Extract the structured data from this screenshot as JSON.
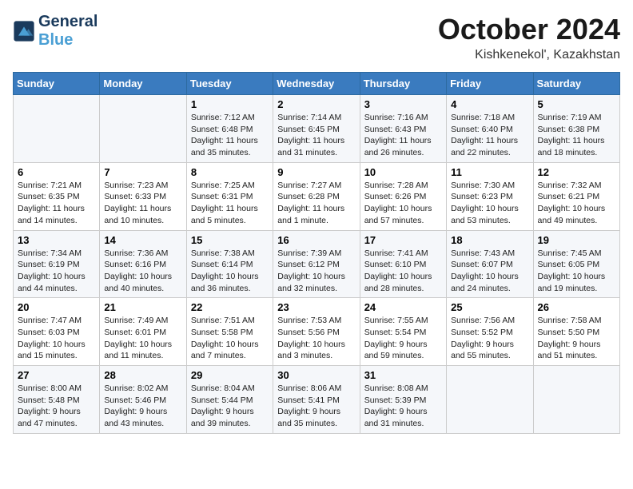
{
  "logo": {
    "line1": "General",
    "line2": "Blue"
  },
  "title": "October 2024",
  "location": "Kishkenekol', Kazakhstan",
  "days_of_week": [
    "Sunday",
    "Monday",
    "Tuesday",
    "Wednesday",
    "Thursday",
    "Friday",
    "Saturday"
  ],
  "weeks": [
    [
      {
        "day": "",
        "info": ""
      },
      {
        "day": "",
        "info": ""
      },
      {
        "day": "1",
        "info": "Sunrise: 7:12 AM\nSunset: 6:48 PM\nDaylight: 11 hours\nand 35 minutes."
      },
      {
        "day": "2",
        "info": "Sunrise: 7:14 AM\nSunset: 6:45 PM\nDaylight: 11 hours\nand 31 minutes."
      },
      {
        "day": "3",
        "info": "Sunrise: 7:16 AM\nSunset: 6:43 PM\nDaylight: 11 hours\nand 26 minutes."
      },
      {
        "day": "4",
        "info": "Sunrise: 7:18 AM\nSunset: 6:40 PM\nDaylight: 11 hours\nand 22 minutes."
      },
      {
        "day": "5",
        "info": "Sunrise: 7:19 AM\nSunset: 6:38 PM\nDaylight: 11 hours\nand 18 minutes."
      }
    ],
    [
      {
        "day": "6",
        "info": "Sunrise: 7:21 AM\nSunset: 6:35 PM\nDaylight: 11 hours\nand 14 minutes."
      },
      {
        "day": "7",
        "info": "Sunrise: 7:23 AM\nSunset: 6:33 PM\nDaylight: 11 hours\nand 10 minutes."
      },
      {
        "day": "8",
        "info": "Sunrise: 7:25 AM\nSunset: 6:31 PM\nDaylight: 11 hours\nand 5 minutes."
      },
      {
        "day": "9",
        "info": "Sunrise: 7:27 AM\nSunset: 6:28 PM\nDaylight: 11 hours\nand 1 minute."
      },
      {
        "day": "10",
        "info": "Sunrise: 7:28 AM\nSunset: 6:26 PM\nDaylight: 10 hours\nand 57 minutes."
      },
      {
        "day": "11",
        "info": "Sunrise: 7:30 AM\nSunset: 6:23 PM\nDaylight: 10 hours\nand 53 minutes."
      },
      {
        "day": "12",
        "info": "Sunrise: 7:32 AM\nSunset: 6:21 PM\nDaylight: 10 hours\nand 49 minutes."
      }
    ],
    [
      {
        "day": "13",
        "info": "Sunrise: 7:34 AM\nSunset: 6:19 PM\nDaylight: 10 hours\nand 44 minutes."
      },
      {
        "day": "14",
        "info": "Sunrise: 7:36 AM\nSunset: 6:16 PM\nDaylight: 10 hours\nand 40 minutes."
      },
      {
        "day": "15",
        "info": "Sunrise: 7:38 AM\nSunset: 6:14 PM\nDaylight: 10 hours\nand 36 minutes."
      },
      {
        "day": "16",
        "info": "Sunrise: 7:39 AM\nSunset: 6:12 PM\nDaylight: 10 hours\nand 32 minutes."
      },
      {
        "day": "17",
        "info": "Sunrise: 7:41 AM\nSunset: 6:10 PM\nDaylight: 10 hours\nand 28 minutes."
      },
      {
        "day": "18",
        "info": "Sunrise: 7:43 AM\nSunset: 6:07 PM\nDaylight: 10 hours\nand 24 minutes."
      },
      {
        "day": "19",
        "info": "Sunrise: 7:45 AM\nSunset: 6:05 PM\nDaylight: 10 hours\nand 19 minutes."
      }
    ],
    [
      {
        "day": "20",
        "info": "Sunrise: 7:47 AM\nSunset: 6:03 PM\nDaylight: 10 hours\nand 15 minutes."
      },
      {
        "day": "21",
        "info": "Sunrise: 7:49 AM\nSunset: 6:01 PM\nDaylight: 10 hours\nand 11 minutes."
      },
      {
        "day": "22",
        "info": "Sunrise: 7:51 AM\nSunset: 5:58 PM\nDaylight: 10 hours\nand 7 minutes."
      },
      {
        "day": "23",
        "info": "Sunrise: 7:53 AM\nSunset: 5:56 PM\nDaylight: 10 hours\nand 3 minutes."
      },
      {
        "day": "24",
        "info": "Sunrise: 7:55 AM\nSunset: 5:54 PM\nDaylight: 9 hours\nand 59 minutes."
      },
      {
        "day": "25",
        "info": "Sunrise: 7:56 AM\nSunset: 5:52 PM\nDaylight: 9 hours\nand 55 minutes."
      },
      {
        "day": "26",
        "info": "Sunrise: 7:58 AM\nSunset: 5:50 PM\nDaylight: 9 hours\nand 51 minutes."
      }
    ],
    [
      {
        "day": "27",
        "info": "Sunrise: 8:00 AM\nSunset: 5:48 PM\nDaylight: 9 hours\nand 47 minutes."
      },
      {
        "day": "28",
        "info": "Sunrise: 8:02 AM\nSunset: 5:46 PM\nDaylight: 9 hours\nand 43 minutes."
      },
      {
        "day": "29",
        "info": "Sunrise: 8:04 AM\nSunset: 5:44 PM\nDaylight: 9 hours\nand 39 minutes."
      },
      {
        "day": "30",
        "info": "Sunrise: 8:06 AM\nSunset: 5:41 PM\nDaylight: 9 hours\nand 35 minutes."
      },
      {
        "day": "31",
        "info": "Sunrise: 8:08 AM\nSunset: 5:39 PM\nDaylight: 9 hours\nand 31 minutes."
      },
      {
        "day": "",
        "info": ""
      },
      {
        "day": "",
        "info": ""
      }
    ]
  ]
}
